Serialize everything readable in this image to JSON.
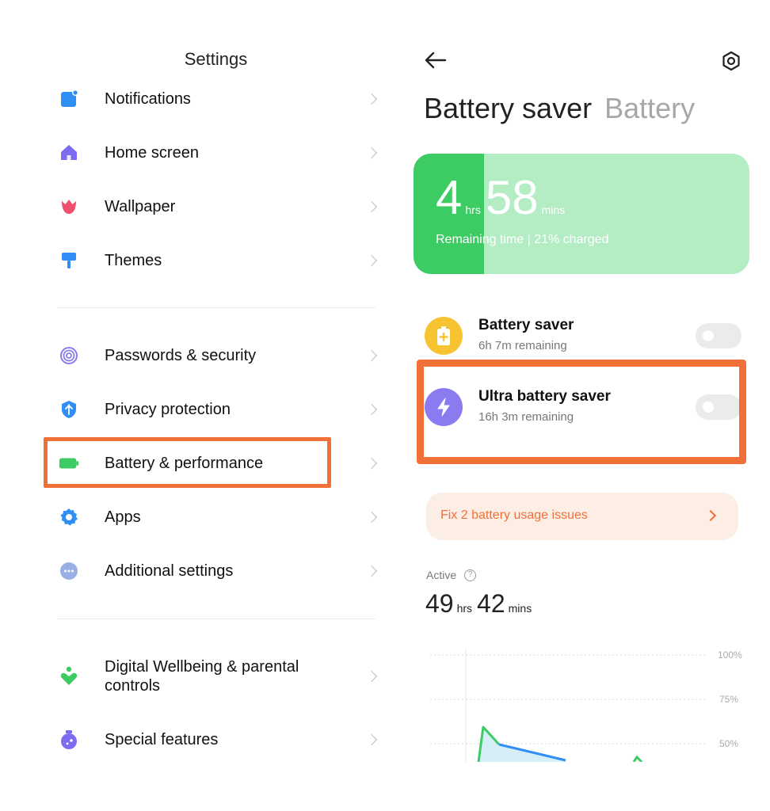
{
  "settings": {
    "title": "Settings",
    "groups": [
      [
        {
          "id": "notifications",
          "label": "Notifications",
          "icon": "notifications-icon",
          "color": "#2f8ff5"
        },
        {
          "id": "home-screen",
          "label": "Home screen",
          "icon": "home-icon",
          "color": "#7c6cf0"
        },
        {
          "id": "wallpaper",
          "label": "Wallpaper",
          "icon": "tulip-icon",
          "color": "#f0506e"
        },
        {
          "id": "themes",
          "label": "Themes",
          "icon": "paint-roller-icon",
          "color": "#2f8ff5"
        }
      ],
      [
        {
          "id": "passwords-security",
          "label": "Passwords & security",
          "icon": "fingerprint-icon",
          "color": "#8a7cf0"
        },
        {
          "id": "privacy-protection",
          "label": "Privacy protection",
          "icon": "shield-icon",
          "color": "#2f8ff5"
        },
        {
          "id": "battery-performance",
          "label": "Battery & performance",
          "icon": "battery-icon",
          "color": "#3ccc63"
        },
        {
          "id": "apps",
          "label": "Apps",
          "icon": "gear-icon",
          "color": "#2f8ff5"
        },
        {
          "id": "additional-settings",
          "label": "Additional settings",
          "icon": "more-dots-icon",
          "color": "#9aaee6"
        }
      ],
      [
        {
          "id": "digital-wellbeing",
          "label": "Digital Wellbeing & parental controls",
          "icon": "heart-person-icon",
          "color": "#3ccc63"
        },
        {
          "id": "special-features",
          "label": "Special features",
          "icon": "potion-icon",
          "color": "#7c6cf0"
        }
      ]
    ]
  },
  "battery": {
    "title_active": "Battery saver",
    "title_inactive": "Battery",
    "remaining": {
      "hours": "4",
      "hours_unit": "hrs",
      "minutes": "58",
      "minutes_unit": "mins",
      "caption": "Remaining time | 21% charged",
      "charge_fraction": 0.21
    },
    "colors": {
      "fill": "#3ccc63",
      "track": "#b4edc4",
      "accent": "#f07038"
    },
    "modes": [
      {
        "id": "battery-saver",
        "title": "Battery saver",
        "subtitle": "6h 7m remaining",
        "icon": "battery-plus-icon",
        "icon_color": "#f7c331",
        "enabled": false
      },
      {
        "id": "ultra-battery-saver",
        "title": "Ultra battery saver",
        "subtitle": "16h 3m remaining",
        "icon": "lightning-icon",
        "icon_color": "#8a7cf0",
        "enabled": false
      }
    ],
    "issues_text": "Fix 2 battery usage issues",
    "active": {
      "label": "Active",
      "hours": "49",
      "hours_unit": "hrs",
      "minutes": "42",
      "minutes_unit": "mins"
    }
  },
  "chart_data": {
    "type": "line",
    "y_ticks": [
      "100%",
      "75%",
      "50%"
    ],
    "ylim": [
      0,
      100
    ],
    "grid": true,
    "note": "partially visible battery level chart"
  }
}
